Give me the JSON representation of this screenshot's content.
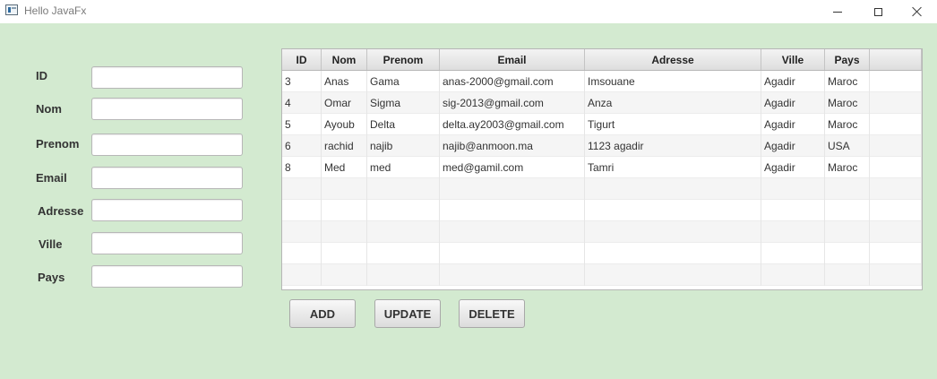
{
  "window": {
    "title": "Hello JavaFx",
    "icon": "javafx-window-icon"
  },
  "form": {
    "fields": [
      {
        "label": "ID",
        "value": ""
      },
      {
        "label": "Nom",
        "value": ""
      },
      {
        "label": "Prenom",
        "value": ""
      },
      {
        "label": "Email",
        "value": ""
      },
      {
        "label": "Adresse",
        "value": ""
      },
      {
        "label": "Ville",
        "value": ""
      },
      {
        "label": "Pays",
        "value": ""
      }
    ]
  },
  "table": {
    "columns": [
      "ID",
      "Nom",
      "Prenom",
      "Email",
      "Adresse",
      "Ville",
      "Pays",
      ""
    ],
    "rows": [
      [
        "3",
        "Anas",
        "Gama",
        "anas-2000@gmail.com",
        " Imsouane",
        "Agadir",
        "Maroc",
        ""
      ],
      [
        "4",
        "Omar",
        "Sigma",
        "sig-2013@gmail.com",
        " Anza",
        "Agadir",
        "Maroc",
        ""
      ],
      [
        "5",
        "Ayoub",
        "Delta",
        "delta.ay2003@gmail.com",
        " Tigurt",
        "Agadir",
        "Maroc",
        ""
      ],
      [
        "6",
        "rachid",
        "najib",
        "najib@anmoon.ma",
        "1123 agadir",
        "Agadir",
        "USA",
        ""
      ],
      [
        "8",
        "Med",
        "med",
        "med@gamil.com",
        "Tamri",
        "Agadir",
        "Maroc",
        ""
      ]
    ],
    "empty_rows": 5
  },
  "buttons": {
    "add": "ADD",
    "update": "UPDATE",
    "delete": "DELETE"
  },
  "colors": {
    "background": "#d3ead0",
    "row_alt": "#f5f5f5"
  }
}
